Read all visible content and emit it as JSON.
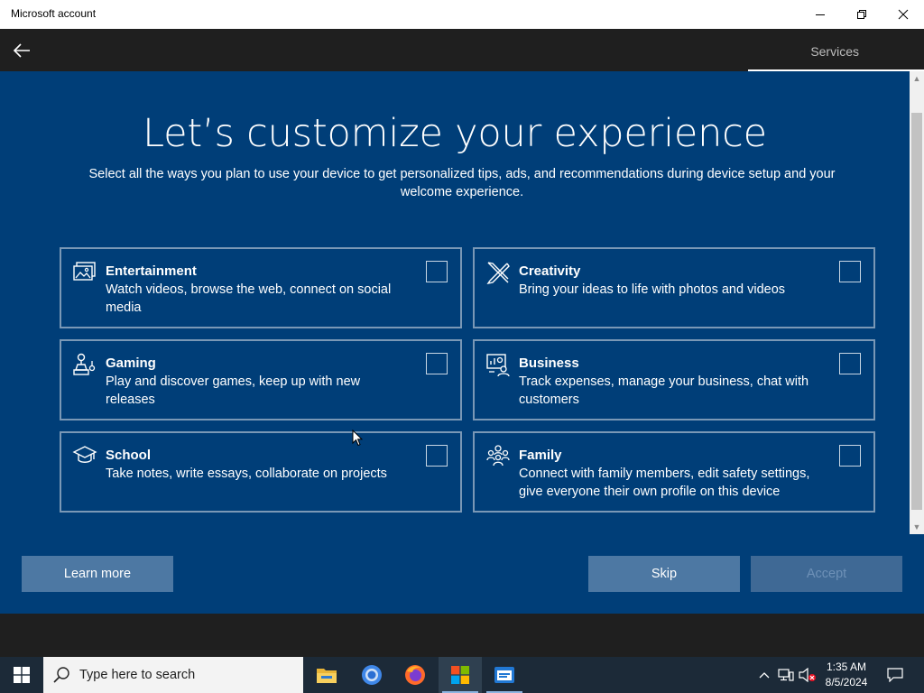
{
  "window": {
    "title": "Microsoft account"
  },
  "header": {
    "breadcrumb": "Services"
  },
  "main": {
    "heading": "Let’s customize your experience",
    "subtitle": "Select all the ways you plan to use your device to get personalized tips, ads, and recommendations during device setup and your welcome experience."
  },
  "cards": [
    {
      "title": "Entertainment",
      "desc": "Watch videos, browse the web, connect on social media",
      "icon": "entertainment-icon",
      "checked": false
    },
    {
      "title": "Creativity",
      "desc": "Bring your ideas to life with photos and videos",
      "icon": "creativity-icon",
      "checked": false
    },
    {
      "title": "Gaming",
      "desc": "Play and discover games, keep up with new releases",
      "icon": "gaming-icon",
      "checked": false
    },
    {
      "title": "Business",
      "desc": "Track expenses, manage your business, chat with customers",
      "icon": "business-icon",
      "checked": false
    },
    {
      "title": "School",
      "desc": "Take notes, write essays, collaborate on projects",
      "icon": "school-icon",
      "checked": false
    },
    {
      "title": "Family",
      "desc": "Connect with family members, edit safety settings, give everyone their own profile on this device",
      "icon": "family-icon",
      "checked": false
    }
  ],
  "buttons": {
    "learn_more": "Learn more",
    "skip": "Skip",
    "accept": "Accept"
  },
  "taskbar": {
    "search_placeholder": "Type here to search",
    "time": "1:35 AM",
    "date": "8/5/2024",
    "apps": [
      "file-explorer-icon",
      "chrome-icon",
      "firefox-icon",
      "microsoft-store-icon",
      "terminal-icon"
    ]
  },
  "colors": {
    "background": "#003e78",
    "card_border": "#7a98b6",
    "button": "#4d78a3",
    "taskbar": "#1c2a38"
  }
}
